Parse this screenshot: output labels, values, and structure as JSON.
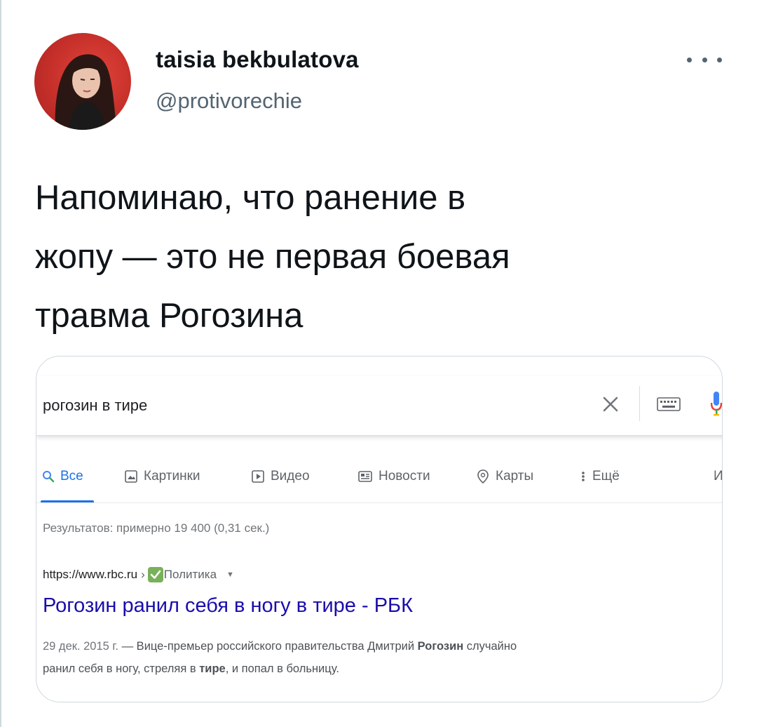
{
  "tweet": {
    "display_name": "taisia bekbulatova",
    "handle": "@protivorechie",
    "text_lines": [
      "Напоминаю, что ранение в",
      "жопу — это не первая боевая",
      "травма Рогозина"
    ]
  },
  "embedded_screenshot": {
    "search": {
      "query": "рогозин в тире"
    },
    "tabs": [
      {
        "label": "Все",
        "icon": "search-icon",
        "active": true
      },
      {
        "label": "Картинки",
        "icon": "image-icon"
      },
      {
        "label": "Видео",
        "icon": "play-icon"
      },
      {
        "label": "Новости",
        "icon": "news-icon"
      },
      {
        "label": "Карты",
        "icon": "map-pin-icon"
      },
      {
        "label": "Ещё",
        "icon": "vertical-dots-icon"
      },
      {
        "label": "И",
        "icon": ""
      }
    ],
    "results_count": "Результатов: примерно 19 400 (0,31 сек.)",
    "result": {
      "url": "https://www.rbc.ru",
      "breadcrumb_sep": "›",
      "crumb": "Политика",
      "crumb_icon": "check-mark-emoji",
      "title": "Рогозин ранил себя в ногу в тире - РБК",
      "snippet_date": "29 дек. 2015 г.",
      "snippet_line1_a": " — Вице-премьер российского правительства Дмитрий ",
      "snippet_line1_bold": "Рогозин",
      "snippet_line1_b": " случайно",
      "snippet_line2_a": "ранил себя в ногу, стреляя в ",
      "snippet_line2_bold": "тире",
      "snippet_line2_b": ", и попал в больницу."
    }
  },
  "colors": {
    "link_blue": "#1a0dab",
    "tab_active": "#1a73e8",
    "text_secondary": "#536471",
    "avatar_bg": "#c62f2a"
  }
}
